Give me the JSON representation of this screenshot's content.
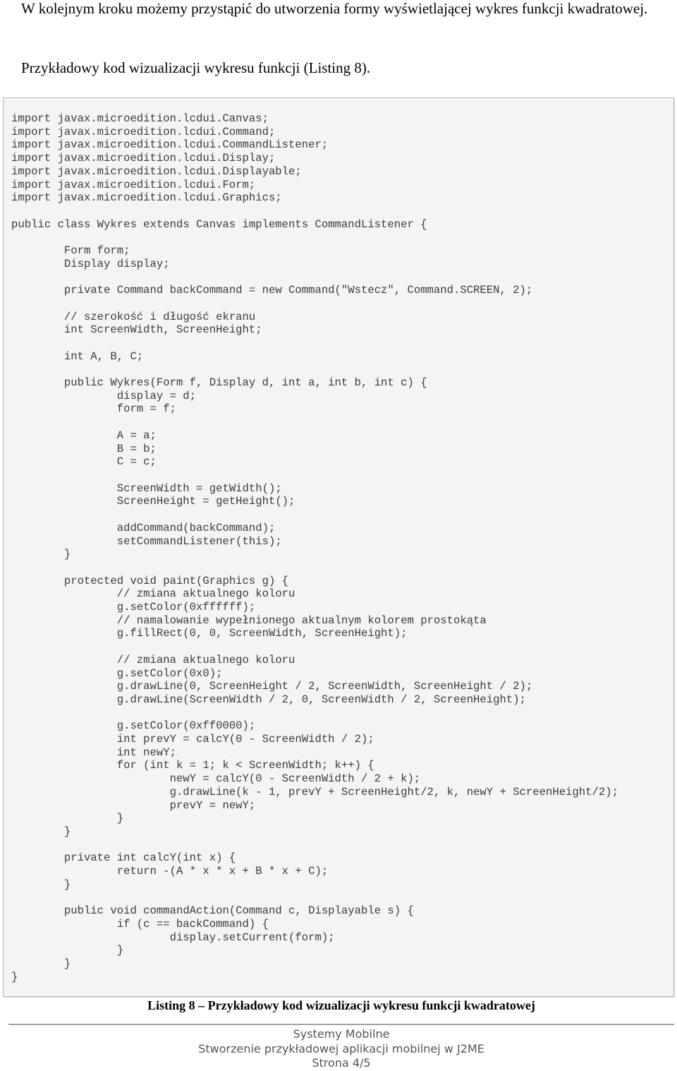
{
  "intro": {
    "paragraph1": "W kolejnym kroku możemy przystąpić do utworzenia formy wyświetlającej wykres funkcji kwadratowej.",
    "paragraph2": "Przykładowy kod wizualizacji wykresu funkcji (Listing 8)."
  },
  "listing": {
    "code_lines": [
      "import javax.microedition.lcdui.Canvas;",
      "import javax.microedition.lcdui.Command;",
      "import javax.microedition.lcdui.CommandListener;",
      "import javax.microedition.lcdui.Display;",
      "import javax.microedition.lcdui.Displayable;",
      "import javax.microedition.lcdui.Form;",
      "import javax.microedition.lcdui.Graphics;",
      "",
      "public class Wykres extends Canvas implements CommandListener {",
      "",
      "\tForm form;",
      "\tDisplay display;",
      "",
      "\tprivate Command backCommand = new Command(\"Wstecz\", Command.SCREEN, 2);",
      "",
      "\t// szerokość i długość ekranu",
      "\tint ScreenWidth, ScreenHeight;",
      "",
      "\tint A, B, C;",
      "",
      "\tpublic Wykres(Form f, Display d, int a, int b, int c) {",
      "\t\tdisplay = d;",
      "\t\tform = f;",
      "",
      "\t\tA = a;",
      "\t\tB = b;",
      "\t\tC = c;",
      "",
      "\t\tScreenWidth = getWidth();",
      "\t\tScreenHeight = getHeight();",
      "",
      "\t\taddCommand(backCommand);",
      "\t\tsetCommandListener(this);",
      "\t}",
      "",
      "\tprotected void paint(Graphics g) {",
      "\t\t// zmiana aktualnego koloru",
      "\t\tg.setColor(0xffffff);",
      "\t\t// namalowanie wypełnionego aktualnym kolorem prostokąta",
      "\t\tg.fillRect(0, 0, ScreenWidth, ScreenHeight);",
      "",
      "\t\t// zmiana aktualnego koloru",
      "\t\tg.setColor(0x0);",
      "\t\tg.drawLine(0, ScreenHeight / 2, ScreenWidth, ScreenHeight / 2);",
      "\t\tg.drawLine(ScreenWidth / 2, 0, ScreenWidth / 2, ScreenHeight);",
      "",
      "\t\tg.setColor(0xff0000);",
      "\t\tint prevY = calcY(0 - ScreenWidth / 2);",
      "\t\tint newY;",
      "\t\tfor (int k = 1; k < ScreenWidth; k++) {",
      "\t\t\tnewY = calcY(0 - ScreenWidth / 2 + k);",
      "\t\t\tg.drawLine(k - 1, prevY + ScreenHeight/2, k, newY + ScreenHeight/2);",
      "\t\t\tprevY = newY;",
      "\t\t}",
      "\t}",
      "",
      "\tprivate int calcY(int x) {",
      "\t\treturn -(A * x * x + B * x + C);",
      "\t}",
      "",
      "\tpublic void commandAction(Command c, Displayable s) {",
      "\t\tif (c == backCommand) {",
      "\t\t\tdisplay.setCurrent(form);",
      "\t\t}",
      "\t}",
      "}"
    ],
    "caption": "Listing 8 – Przykładowy kod wizualizacji wykresu funkcji kwadratowej"
  },
  "footer": {
    "line1": "Systemy Mobilne",
    "line2": "Stworzenie przykładowej aplikacji mobilnej w J2ME",
    "line3": "Strona 4/5"
  }
}
